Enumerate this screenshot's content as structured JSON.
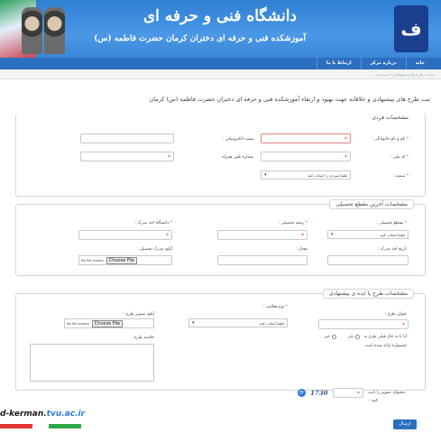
{
  "header": {
    "title_main": "دانشگاه فنی و حرفه ای",
    "title_sub": "آموزشکده فنی و حرفه ای دختران کرمان حضرت فاطمه (س)",
    "logo_mark": "ف"
  },
  "nav": {
    "items": [
      "خانه",
      "درباره مرکز",
      "ارتباط با ما"
    ]
  },
  "breadcrumb": "خانه » طرح ها و پیشنهادات » ثبت ایده",
  "page_title": "ثبت طرح های پیشنهادی و خلاقانه جهت بهبود و ارتقاء آموزشکده فنی و حرفه ای دختران حضرت فاطمه (س) کرمان",
  "personal": {
    "legend": "مشخصات فردی",
    "name_label": "نام و نام خانوادگی :",
    "email_label": "پست الکترونیکی :",
    "nid_label": "کد ملی :",
    "phone_label": "شماره تلفن همراه :",
    "role_label": "سمت :",
    "role_placeholder": "لطفا موردی را انتخاب کنید"
  },
  "education": {
    "legend": "مشخصات آخرین مقطع تحصیلی",
    "degree_label": "مقطع تحصیلی :",
    "degree_placeholder": "لطفا انتخاب کنید",
    "field_label": "رشته تحصیلی :",
    "university_label": "دانشگاه اخذ مدرک :",
    "year_label": "تاریخ اخذ مدرک :",
    "grade_label": "معدل :",
    "upload_label": "آپلود مدرک تحصیلی :",
    "file_button": "Choose File",
    "file_text": "No file chosen"
  },
  "idea": {
    "legend": "مشخصات طرح یا ایده ی پیشنهادی",
    "title_label": "عنوان طرح :",
    "type_label": "نوع فعالیت :",
    "type_placeholder": "لطفا انتخاب کنید",
    "image_label": "آپلود تصویر طرح :",
    "file_button": "Choose File",
    "file_text": "No file chosen",
    "summary_label": "خلاصه طرح :",
    "question": "آیا تا به حال قبلی طرح به",
    "opt_yes": "بلی",
    "opt_no": "خیر",
    "note": "جشنواره ارائه شده است"
  },
  "captcha": {
    "label": "محتوای تصویر را تایپ",
    "label2": "کنید :",
    "code": "1730"
  },
  "submit_label": "ارسال",
  "watermark": {
    "text_a": "d-kerman.",
    "text_b": "tvu.ac.ir"
  }
}
